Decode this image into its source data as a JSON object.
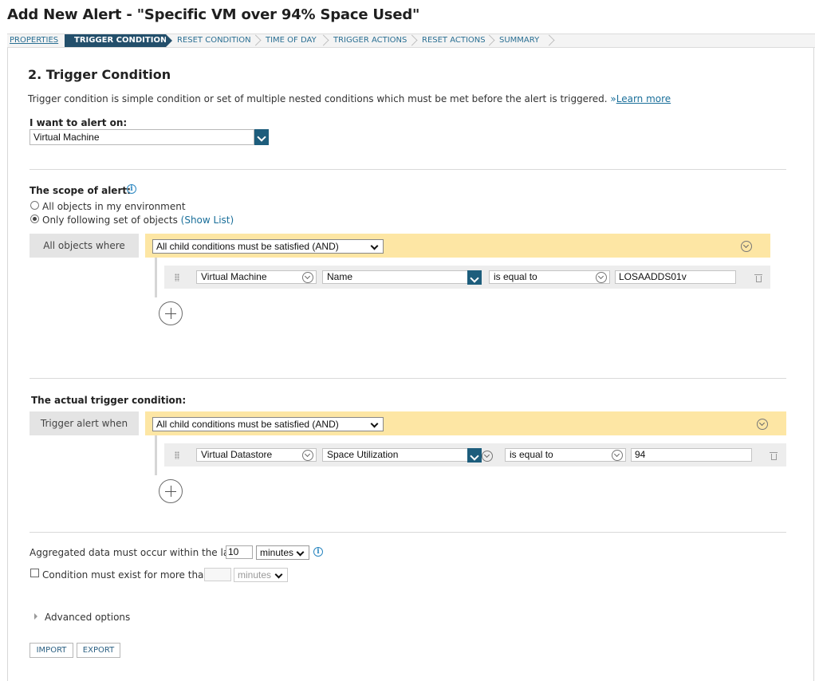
{
  "title": "Add New Alert - \"Specific VM over 94% Space Used\"",
  "wizard": {
    "steps": [
      "PROPERTIES",
      "TRIGGER CONDITION",
      "RESET CONDITION",
      "TIME OF DAY",
      "TRIGGER ACTIONS",
      "RESET ACTIONS",
      "SUMMARY"
    ],
    "active_step": "TRIGGER CONDITION"
  },
  "section": {
    "title": "2. Trigger Condition",
    "description": "Trigger condition is simple condition or set of multiple nested conditions which must be met before the alert is triggered.",
    "learn_more_prefix": "»",
    "learn_more": "Learn more"
  },
  "alert_on": {
    "label": "I want to alert on:",
    "value": "Virtual Machine"
  },
  "scope": {
    "label": "The scope of alert:",
    "options": [
      "All objects in my environment",
      "Only following set of objects"
    ],
    "selected_option": "Only following set of objects",
    "show_list": "(Show List)",
    "tab_label": "All objects where",
    "group_condition": "All child conditions must be satisfied (AND)",
    "condition": {
      "object": "Virtual Machine",
      "property": "Name",
      "operator": "is equal to",
      "value": "LOSAADDS01v"
    }
  },
  "trigger": {
    "label": "The actual trigger condition:",
    "tab_label": "Trigger alert when",
    "group_condition": "All child conditions must be satisfied (AND)",
    "condition": {
      "object": "Virtual Datastore",
      "property": "Space Utilization",
      "operator": "is equal to",
      "value": "94"
    }
  },
  "aggregation": {
    "label": "Aggregated data must occur within the last",
    "value": "10",
    "unit": "minutes"
  },
  "duration": {
    "label": "Condition must exist for more than",
    "value": "",
    "unit": "minutes",
    "checked": false
  },
  "advanced_options": "Advanced options",
  "buttons": {
    "import": "IMPORT",
    "export": "EXPORT"
  }
}
